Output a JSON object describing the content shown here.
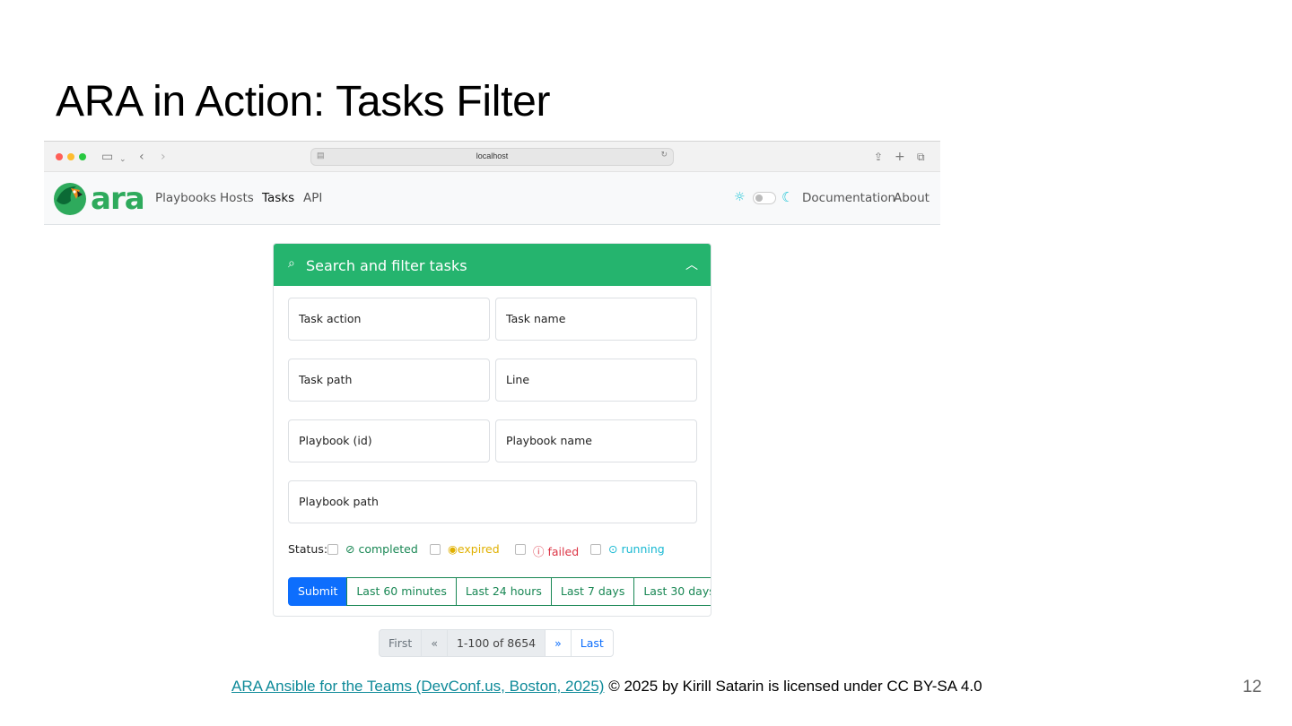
{
  "slide": {
    "title": "ARA in Action: Tasks Filter",
    "page_number": "12",
    "footer_link": "ARA Ansible for the Teams (DevConf.us, Boston, 2025)",
    "footer_text": " © 2025 by Kirill Satarin is licensed under CC BY-SA 4.0"
  },
  "browser": {
    "url": "localhost"
  },
  "navbar": {
    "brand": "ara",
    "links": [
      "Playbooks",
      "Hosts",
      "Tasks",
      "API"
    ],
    "active": "Tasks",
    "right_links": [
      "Documentation",
      "About"
    ]
  },
  "filter_card": {
    "header": "Search and filter tasks",
    "fields": {
      "task_action": "Task action",
      "task_name": "Task name",
      "task_path": "Task path",
      "line": "Line",
      "playbook_id": "Playbook (id)",
      "playbook_name": "Playbook name",
      "playbook_path": "Playbook path"
    },
    "status_label": "Status:",
    "statuses": {
      "completed": "completed",
      "expired": "expired",
      "failed": "failed",
      "running": "running"
    },
    "buttons": {
      "submit": "Submit",
      "last_60": "Last 60 minutes",
      "last_24": "Last 24 hours",
      "last_7": "Last 7 days",
      "last_30": "Last 30 days"
    }
  },
  "pagination": {
    "first": "First",
    "prev": "«",
    "info": "1-100 of 8654",
    "next": "»",
    "last": "Last"
  },
  "colors": {
    "header_green": "#25b46e",
    "submit_blue": "#0d6efd",
    "completed": "#198754",
    "expired": "#e0b000",
    "failed": "#dc3545",
    "running": "#17b8d2"
  },
  "icons": {
    "search": "search-icon",
    "collapse": "chevron-up-icon",
    "sun": "sun-icon",
    "moon": "moon-icon"
  }
}
